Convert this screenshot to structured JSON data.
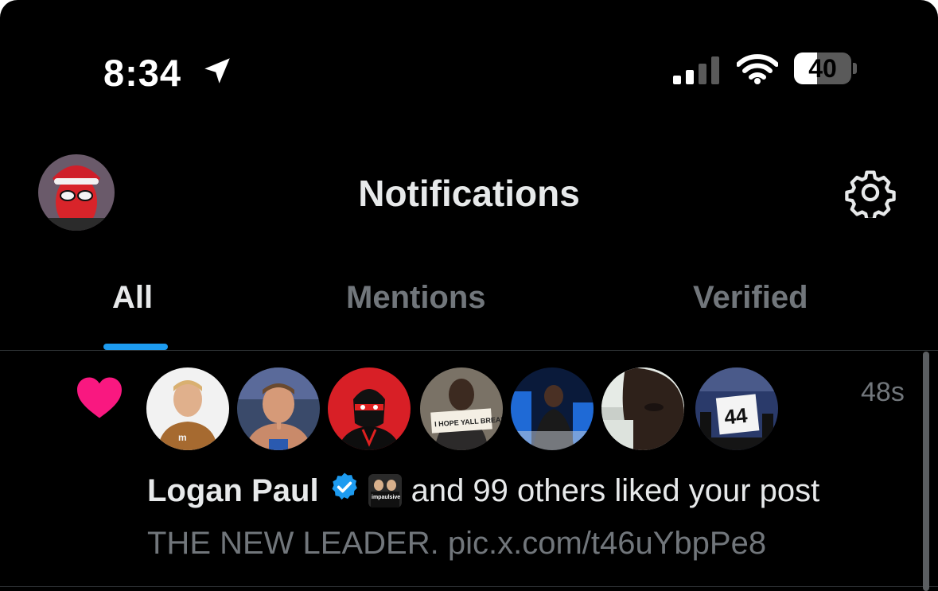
{
  "status_bar": {
    "time": "8:34",
    "battery_level": "40",
    "battery_fraction": 0.4,
    "signal_bars_active": 2,
    "signal_bars_total": 4
  },
  "header": {
    "title": "Notifications"
  },
  "tabs": [
    {
      "label": "All",
      "selected": true
    },
    {
      "label": "Mentions",
      "selected": false
    },
    {
      "label": "Verified",
      "selected": false
    }
  ],
  "notification": {
    "time_ago": "48s",
    "actor_name": "Logan Paul",
    "rest_text": "and 99 others liked your post",
    "post_preview": "THE NEW LEADER. pic.x.com/t46uYbpPe8",
    "mini_avatar_text": "impaulsive"
  },
  "colors": {
    "accent": "#1d9bf0",
    "like": "#f91880",
    "text_primary": "#e7e9ea",
    "text_secondary": "#71767b",
    "background": "#000000"
  },
  "icons": [
    "location-arrow-icon",
    "cellular-signal-icon",
    "wifi-icon",
    "battery-icon",
    "gear-icon",
    "heart-icon",
    "verified-badge-icon"
  ]
}
